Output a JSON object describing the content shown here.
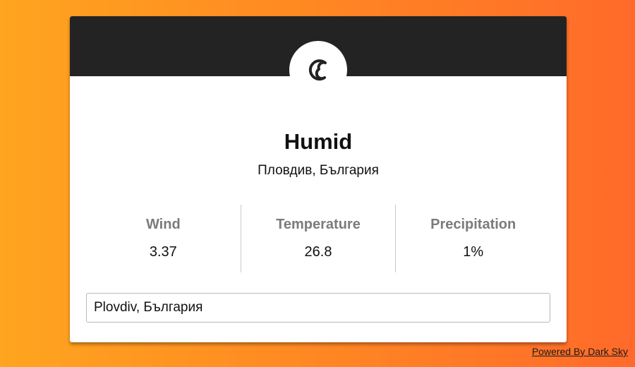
{
  "weather": {
    "icon": "humidity-icon",
    "summary": "Humid",
    "location": "Пловдив, България"
  },
  "stats": [
    {
      "label": "Wind",
      "value": "3.37"
    },
    {
      "label": "Temperature",
      "value": "26.8"
    },
    {
      "label": "Precipitation",
      "value": "1%"
    }
  ],
  "search": {
    "value": "Plovdiv, България"
  },
  "footer": {
    "powered_by": "Powered By Dark Sky"
  },
  "colors": {
    "header": "#232323",
    "background_start": "#ffa51f",
    "background_end": "#ff6a2a",
    "label_gray": "#7b7b7b"
  }
}
